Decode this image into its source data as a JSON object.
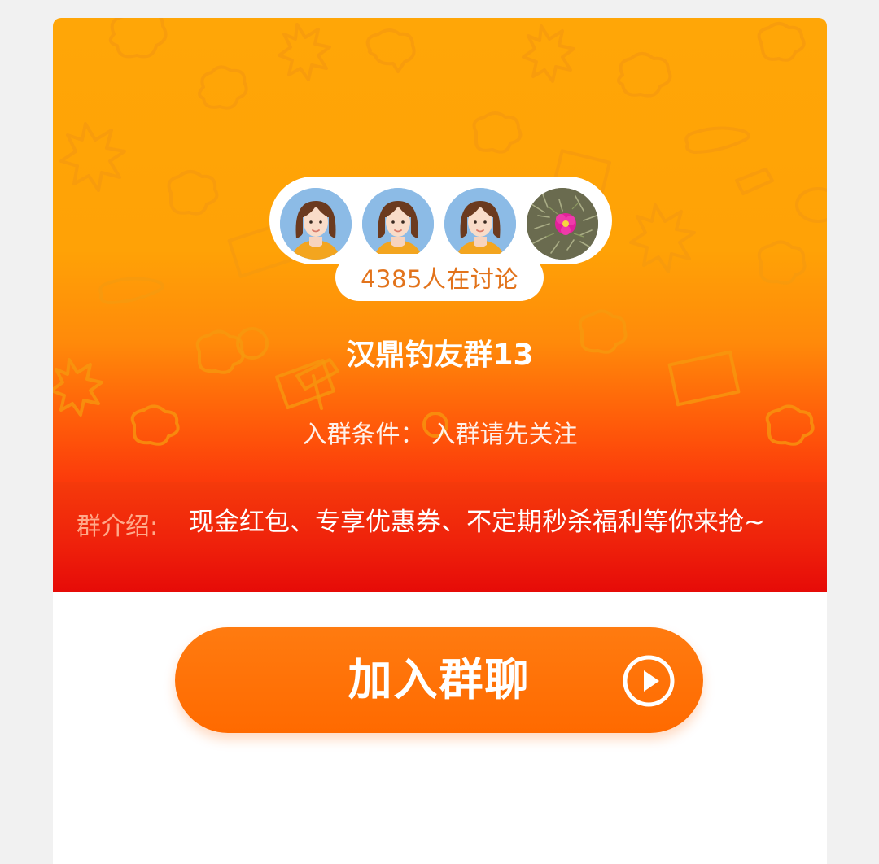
{
  "group": {
    "member_count_text": "4385人在讨论",
    "name": "汉鼎钓友群13",
    "condition_label": "入群条件：",
    "condition_value": "入群请先关注",
    "intro_label": "群介绍:",
    "intro_text": "现金红包、专享优惠券、不定期秒杀福利等你来抢~"
  },
  "avatars": [
    {
      "icon": "female-avatar-icon"
    },
    {
      "icon": "female-avatar-icon"
    },
    {
      "icon": "female-avatar-icon"
    },
    {
      "icon": "flower-photo-avatar"
    }
  ],
  "actions": {
    "join_label": "加入群聊",
    "join_icon": "play-circle-icon"
  },
  "colors": {
    "accent_orange": "#ff6a00",
    "header_orange": "#ffa607",
    "intro_red": "#e60b08",
    "count_text": "#e2731b"
  }
}
